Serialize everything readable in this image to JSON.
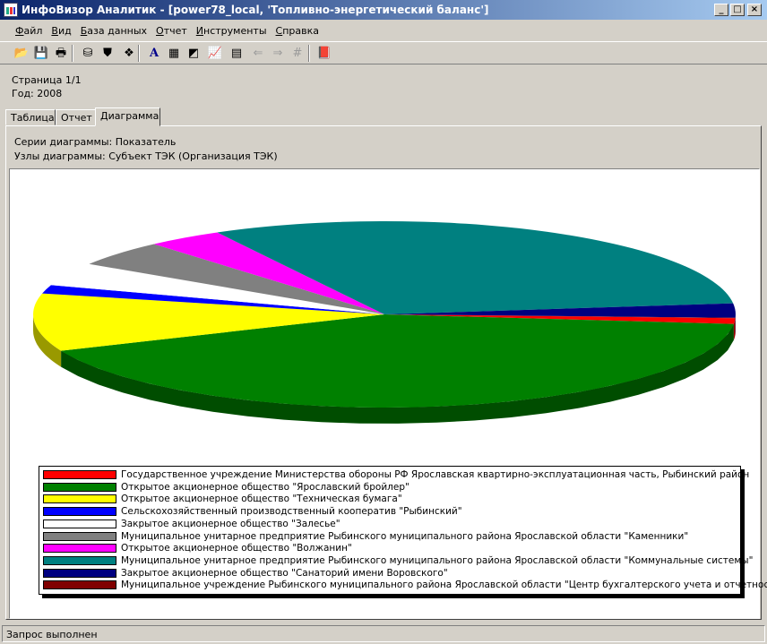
{
  "window": {
    "title": "ИнфоВизор Аналитик - [power78_local, 'Топливно-энергетический баланс']",
    "buttons": [
      "_",
      "□",
      "×"
    ]
  },
  "menu": [
    {
      "label": "Файл",
      "key": "Ф",
      "rest": "айл"
    },
    {
      "label": "Вид",
      "key": "В",
      "rest": "ид"
    },
    {
      "label": "База данных",
      "key": "Б",
      "rest": "аза данных"
    },
    {
      "label": "Отчет",
      "key": "О",
      "rest": "тчет"
    },
    {
      "label": "Инструменты",
      "key": "И",
      "rest": "нструменты"
    },
    {
      "label": "Справка",
      "key": "С",
      "rest": "правка"
    }
  ],
  "toolbar": [
    {
      "icon": "open-folder-icon",
      "glyph": "📂"
    },
    {
      "icon": "save-icon",
      "glyph": "💾"
    },
    {
      "icon": "print-icon",
      "glyph": "🖶"
    },
    {
      "icon": "database-icon",
      "glyph": "⛁"
    },
    {
      "icon": "filter-icon",
      "glyph": "⛊"
    },
    {
      "icon": "new-item-icon",
      "glyph": "❖"
    },
    {
      "icon": "font-icon",
      "glyph": "A"
    },
    {
      "icon": "table-icon",
      "glyph": "▦"
    },
    {
      "icon": "chart-settings-icon",
      "glyph": "◩"
    },
    {
      "icon": "chart-icon",
      "glyph": "📈"
    },
    {
      "icon": "report-icon",
      "glyph": "▤"
    },
    {
      "icon": "back-arrow-icon",
      "glyph": "⇐"
    },
    {
      "icon": "forward-arrow-icon",
      "glyph": "⇒"
    },
    {
      "icon": "grid-icon",
      "glyph": "#"
    },
    {
      "icon": "book-icon",
      "glyph": "📕"
    }
  ],
  "info": {
    "page": "Страница 1/1",
    "year": "Год: 2008"
  },
  "tabs": [
    {
      "label": "Таблица",
      "active": false
    },
    {
      "label": "Отчет",
      "active": false
    },
    {
      "label": "Диаграмма",
      "active": true
    }
  ],
  "diagram": {
    "series": "Серии диаграммы: Показатель",
    "nodes": "Узлы диаграммы: Субъект ТЭК (Организация ТЭК)"
  },
  "chart_data": {
    "type": "pie",
    "slices": [
      {
        "label": "Государственное учреждение Министерства обороны РФ Ярославская квартирно-эксплуатационная часть, Рыбинский район",
        "color": "#ff0000",
        "value": 1.0
      },
      {
        "label": "Открытое акционерное общество \"Ярославский бройлер\"",
        "color": "#008000",
        "value": 42.0
      },
      {
        "label": "Открытое акционерное общество \"Техническая бумага\"",
        "color": "#ffff00",
        "value": 10.0
      },
      {
        "label": "Сельскохозяйственный производственный кооператив \"Рыбинский\"",
        "color": "#0000ff",
        "value": 1.5
      },
      {
        "label": "Закрытое акционерное общество \"Залесье\"",
        "color": "#ffffff",
        "value": 4.0
      },
      {
        "label": "Муниципальное унитарное предприятие Рыбинского муниципального района Ярославской области \"Каменники\"",
        "color": "#808080",
        "value": 4.5
      },
      {
        "label": "Открытое акционерное общество \"Волжанин\"",
        "color": "#ff00ff",
        "value": 3.5
      },
      {
        "label": "Муниципальное унитарное предприятие Рыбинского муниципального района Ярославской области \"Коммунальные системы\"",
        "color": "#008080",
        "value": 31.0
      },
      {
        "label": "Закрытое акционерное общество \"Санаторий имени Воровского\"",
        "color": "#000080",
        "value": 2.5
      },
      {
        "label": "Муниципальное учреждение Рыбинского муниципального района Ярославской области \"Центр бухгалтерского учета и отчетности\"",
        "color": "#800000",
        "value": 0.05
      }
    ]
  },
  "status": "Запрос выполнен"
}
